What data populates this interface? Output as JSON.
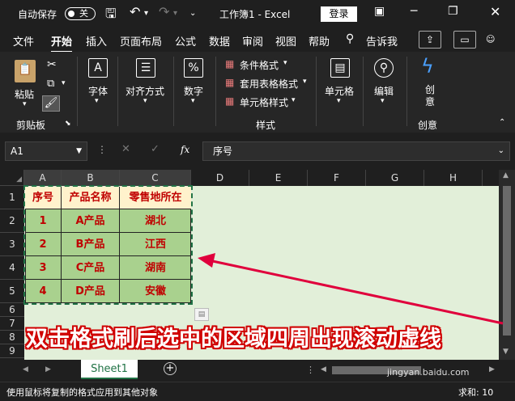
{
  "title_bar": {
    "autosave_label": "自动保存",
    "autosave_state": "关",
    "doc_title": "工作簿1 - Excel",
    "login": "登录"
  },
  "tabs": [
    "文件",
    "开始",
    "插入",
    "页面布局",
    "公式",
    "数据",
    "审阅",
    "视图",
    "帮助",
    "告诉我"
  ],
  "ribbon": {
    "clipboard": {
      "paste": "粘贴",
      "group": "剪贴板"
    },
    "font": "字体",
    "align": "对齐方式",
    "number": "数字",
    "styles": {
      "cond": "条件格式",
      "table": "套用表格格式",
      "cell": "单元格样式",
      "group": "样式"
    },
    "cells": "单元格",
    "edit": "编辑",
    "creative": {
      "label": "创意",
      "group": "创意"
    }
  },
  "formula_bar": {
    "name_box": "A1",
    "fx": "fx",
    "content": "序号"
  },
  "columns": [
    "A",
    "B",
    "C",
    "D",
    "E",
    "F",
    "G",
    "H"
  ],
  "rows": [
    "1",
    "2",
    "3",
    "4",
    "5",
    "6",
    "7",
    "8",
    "9"
  ],
  "table": {
    "headers": [
      "序号",
      "产品名称",
      "零售地所在"
    ],
    "rows": [
      [
        "1",
        "A产品",
        "湖北"
      ],
      [
        "2",
        "B产品",
        "江西"
      ],
      [
        "3",
        "C产品",
        "湖南"
      ],
      [
        "4",
        "D产品",
        "安徽"
      ]
    ]
  },
  "annotation": "双击格式刷后选中的区域四周出现滚动虚线",
  "sheet_tab": "Sheet1",
  "status": {
    "message": "使用鼠标将复制的格式应用到其他对象",
    "count": "求和: 10"
  },
  "watermark": "jingyan.baidu.com",
  "colors": {
    "sheet_bg": "#e2efd9",
    "text_red": "#c00000",
    "annotation_stroke": "#d00000",
    "arrow": "#e0003c"
  }
}
